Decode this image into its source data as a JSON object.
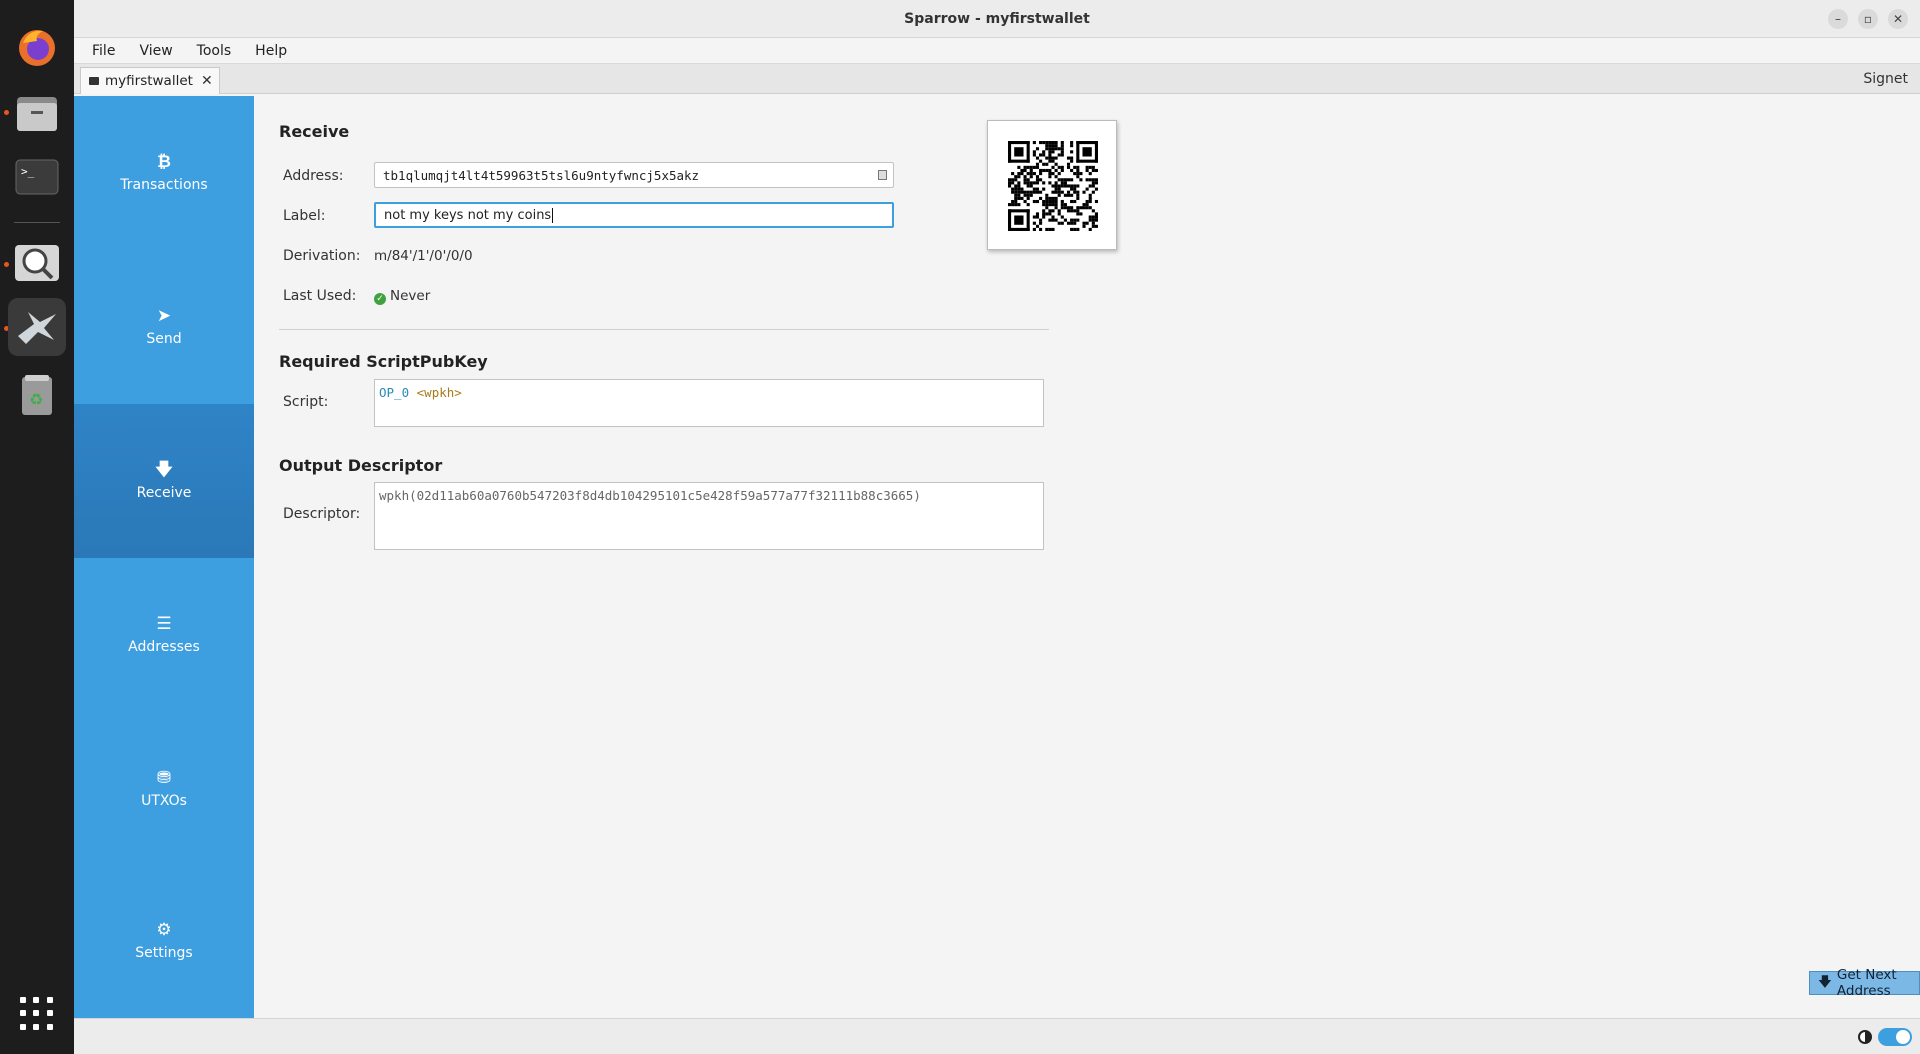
{
  "window": {
    "title": "Sparrow - myfirstwallet",
    "controls": [
      "–",
      "▫",
      "✕"
    ]
  },
  "menu": [
    "File",
    "View",
    "Tools",
    "Help"
  ],
  "tab": {
    "label": "myfirstwallet",
    "close": "✕"
  },
  "network": "Signet",
  "sidebar": {
    "items": [
      {
        "label": "Transactions",
        "icon": "bitcoin-icon",
        "glyph": "₿"
      },
      {
        "label": "Send",
        "icon": "paper-plane-icon",
        "glyph": "➤"
      },
      {
        "label": "Receive",
        "icon": "arrow-down-icon",
        "glyph": "🡇"
      },
      {
        "label": "Addresses",
        "icon": "list-icon",
        "glyph": "☰"
      },
      {
        "label": "UTXOs",
        "icon": "coins-icon",
        "glyph": "⛃"
      },
      {
        "label": "Settings",
        "icon": "gear-icon",
        "glyph": "⚙"
      }
    ],
    "active": "Receive"
  },
  "receive": {
    "title": "Receive",
    "address_label": "Address:",
    "address_value": "tb1qlumqjt4lt4t59963t5tsl6u9ntyfwncj5x5akz",
    "label_label": "Label:",
    "label_value": "not my keys not my coins",
    "derivation_label": "Derivation:",
    "derivation_value": "m/84'/1'/0'/0/0",
    "last_used_label": "Last Used:",
    "last_used_value": "Never"
  },
  "script_section": {
    "title": "Required ScriptPubKey",
    "script_label": "Script:",
    "op": "OP_0",
    "param": "<wpkh>"
  },
  "descriptor_section": {
    "title": "Output Descriptor",
    "descriptor_label": "Descriptor:",
    "descriptor_value": "wpkh(02d11ab60a0760b547203f8d4db104295101c5e428f59a577a77f32111b88c3665)"
  },
  "actions": {
    "get_next_address": "Get Next Address"
  },
  "colors": {
    "sidebar": "#3d9ee0",
    "sidebar_active": "#2e7fbf",
    "focus": "#3d9ee0"
  }
}
